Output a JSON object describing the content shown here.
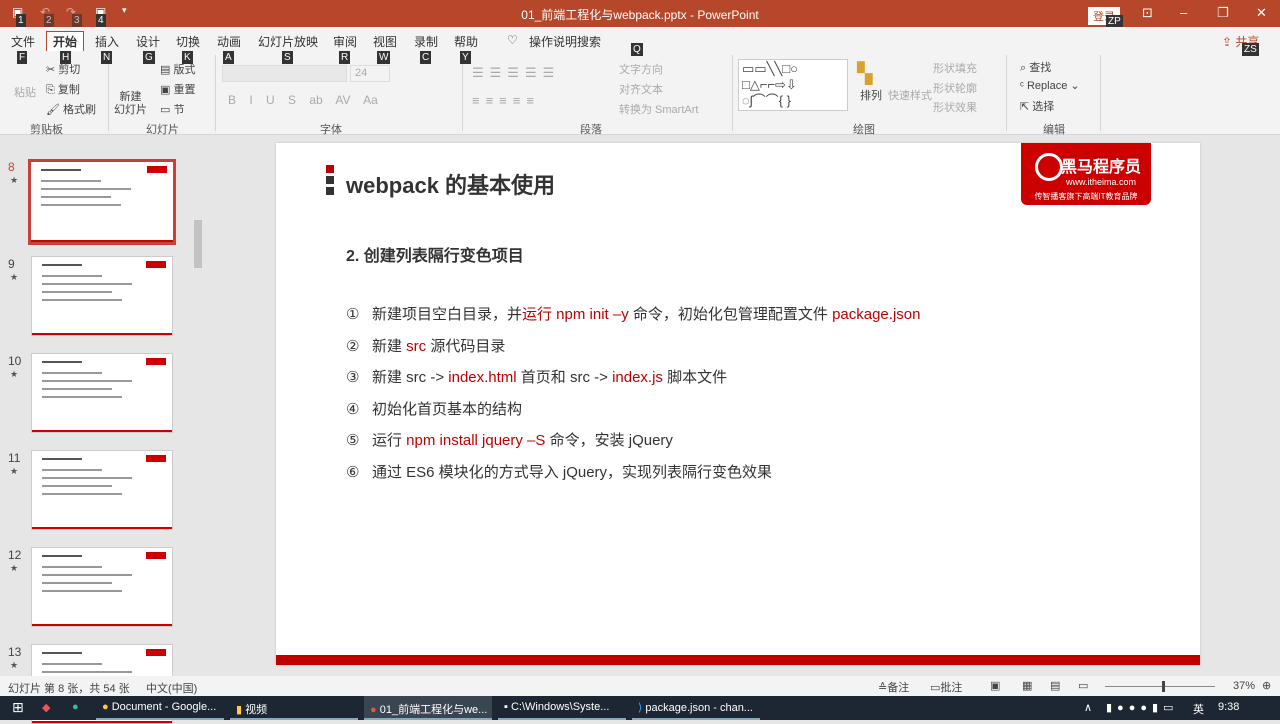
{
  "window": {
    "title": "01_前端工程化与webpack.pptx - PowerPoint",
    "login": "登录",
    "share": "共享",
    "key_tips": {
      "login": "ZP",
      "share": "ZS",
      "quick": [
        "1",
        "2",
        "3",
        "4"
      ]
    }
  },
  "tabs": [
    {
      "label": "文件",
      "key": "F"
    },
    {
      "label": "开始",
      "key": "H",
      "active": true
    },
    {
      "label": "插入",
      "key": "N"
    },
    {
      "label": "设计",
      "key": "G"
    },
    {
      "label": "切换",
      "key": "K"
    },
    {
      "label": "动画",
      "key": "A"
    },
    {
      "label": "幻灯片放映",
      "key": "S"
    },
    {
      "label": "审阅",
      "key": "R"
    },
    {
      "label": "视图",
      "key": "W"
    },
    {
      "label": "录制",
      "key": "C"
    },
    {
      "label": "帮助",
      "key": "Y"
    }
  ],
  "tell_me": {
    "label": "操作说明搜索",
    "key": "Q"
  },
  "ribbon": {
    "clipboard": {
      "paste": "粘贴",
      "cut": "剪切",
      "copy": "复制",
      "format_painter": "格式刷",
      "group": "剪贴板"
    },
    "slides": {
      "new_slide": "新建\n幻灯片",
      "layout": "版式",
      "reset": "重置",
      "section": "节",
      "group": "幻灯片"
    },
    "font": {
      "size": "24",
      "group": "字体",
      "buttons": [
        "B",
        "I",
        "U",
        "S",
        "ab",
        "AV",
        "Aa"
      ]
    },
    "paragraph": {
      "text_direction": "文字方向",
      "align_text": "对齐文本",
      "smartart": "转换为 SmartArt",
      "group": "段落"
    },
    "drawing": {
      "arrange": "排列",
      "quick_styles": "快速样式",
      "fill": "形状填充",
      "outline": "形状轮廓",
      "effects": "形状效果",
      "group": "绘图"
    },
    "editing": {
      "find": "查找",
      "replace": "Replace",
      "select": "选择",
      "group": "编辑"
    }
  },
  "thumbnails": [
    {
      "num": "8",
      "selected": true
    },
    {
      "num": "9"
    },
    {
      "num": "10"
    },
    {
      "num": "11"
    },
    {
      "num": "12"
    },
    {
      "num": "13"
    }
  ],
  "slide": {
    "title": "webpack 的基本使用",
    "logo": {
      "name": "黑马程序员",
      "url": "www.itheima.com",
      "tagline": "传智播客旗下高端IT教育品牌"
    },
    "subtitle": "2. 创建列表隔行变色项目",
    "items": [
      {
        "num": "①",
        "segments": [
          {
            "text": "新建项目空白目录，并"
          },
          {
            "text": "运行 npm init –y",
            "red": true
          },
          {
            "text": " 命令，初始化包管理配置文件 "
          },
          {
            "text": "package.json",
            "red": true
          }
        ]
      },
      {
        "num": "②",
        "segments": [
          {
            "text": "新建 "
          },
          {
            "text": "src",
            "red": true
          },
          {
            "text": " 源代码目录"
          }
        ]
      },
      {
        "num": "③",
        "segments": [
          {
            "text": "新建 src -> "
          },
          {
            "text": "index.html",
            "red": true
          },
          {
            "text": " 首页和 src -> "
          },
          {
            "text": "index.js",
            "red": true
          },
          {
            "text": " 脚本文件"
          }
        ]
      },
      {
        "num": "④",
        "segments": [
          {
            "text": "初始化首页基本的结构"
          }
        ]
      },
      {
        "num": "⑤",
        "segments": [
          {
            "text": "运行 "
          },
          {
            "text": "npm install jquery –S",
            "red": true
          },
          {
            "text": " 命令，安装 jQuery"
          }
        ]
      },
      {
        "num": "⑥",
        "segments": [
          {
            "text": "通过 ES6 模块化的方式导入 jQuery，实现列表隔行变色效果"
          }
        ]
      }
    ]
  },
  "status": {
    "slide_info": "幻灯片 第 8 张，共 54 张",
    "language": "中文(中国)",
    "notes": "备注",
    "comments": "批注",
    "zoom": "37%"
  },
  "taskbar": {
    "items": [
      "Document - Google...",
      "视频",
      "01_前端工程化与we...",
      "C:\\Windows\\Syste...",
      "package.json - chan..."
    ],
    "ime": "英",
    "time": "9:38"
  },
  "colors": {
    "accent": "#b7472a",
    "slide_red": "#c00000"
  }
}
